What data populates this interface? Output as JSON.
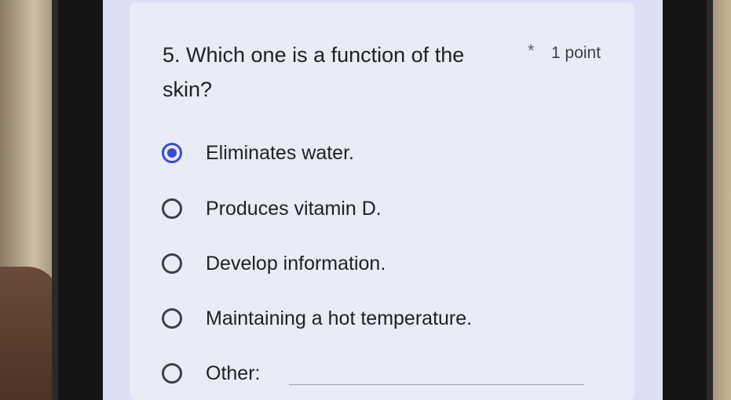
{
  "question": {
    "text": "5. Which one is a function of the skin?",
    "required_marker": "*",
    "points": "1 point"
  },
  "options": [
    {
      "label": "Eliminates water.",
      "selected": true
    },
    {
      "label": "Produces vitamin D.",
      "selected": false
    },
    {
      "label": "Develop information.",
      "selected": false
    },
    {
      "label": "Maintaining a hot temperature.",
      "selected": false
    },
    {
      "label": "Other:",
      "selected": false
    }
  ],
  "colors": {
    "accent": "#3b4bd6",
    "card": "#e9ebf7",
    "text": "#202124"
  }
}
